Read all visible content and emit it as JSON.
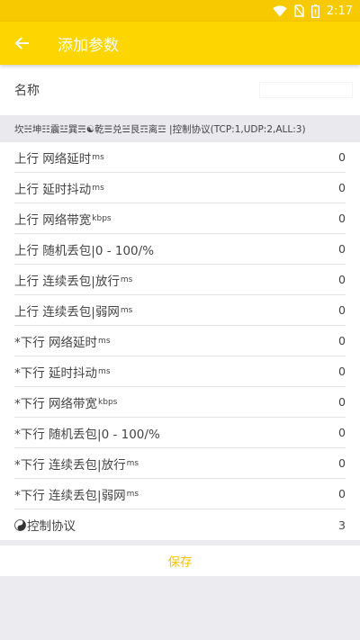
{
  "status_bar": {
    "time": "2:17"
  },
  "app_bar": {
    "title": "添加参数"
  },
  "name_field": {
    "label": "名称",
    "value": ""
  },
  "hint": "坎☵坤☷震☳巽☴☯乾☰兑☱艮☶离☲ |控制协议(TCP:1,UDP:2,ALL:3)",
  "params": [
    {
      "label": "上行 网络延时",
      "unit": "ms",
      "value": "0"
    },
    {
      "label": "上行 延时抖动",
      "unit": "ms",
      "value": "0"
    },
    {
      "label": "上行 网络带宽",
      "unit": "kbps",
      "value": "0"
    },
    {
      "label": "上行 随机丢包|0 - 100/%",
      "unit": "",
      "value": "0"
    },
    {
      "label": "上行 连续丢包|放行",
      "unit": "ms",
      "value": "0"
    },
    {
      "label": "上行 连续丢包|弱网",
      "unit": "ms",
      "value": "0"
    },
    {
      "label": "*下行 网络延时",
      "unit": "ms",
      "value": "0"
    },
    {
      "label": "*下行 延时抖动",
      "unit": "ms",
      "value": "0"
    },
    {
      "label": "*下行 网络带宽",
      "unit": "kbps",
      "value": "0"
    },
    {
      "label": "*下行 随机丢包|0 - 100/%",
      "unit": "",
      "value": "0"
    },
    {
      "label": "*下行 连续丢包|放行",
      "unit": "ms",
      "value": "0"
    },
    {
      "label": "*下行 连续丢包|弱网",
      "unit": "ms",
      "value": "0"
    }
  ],
  "protocol": {
    "label": "控制协议",
    "value": "3"
  },
  "save_label": "保存",
  "colors": {
    "app_bar": "#fdd500",
    "status_bar": "#f7c900",
    "save_text": "#f5c400",
    "background": "#ebebf0"
  }
}
